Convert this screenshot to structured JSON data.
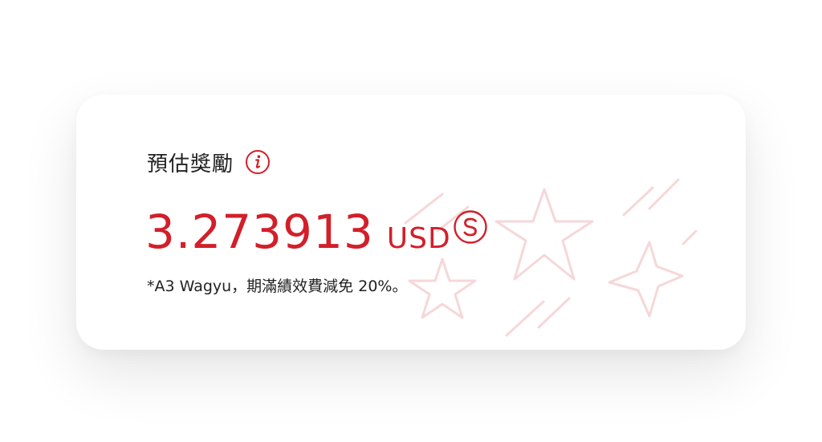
{
  "reward_card": {
    "title": "預估獎勵",
    "amount": "3.273913",
    "currency": "USD",
    "note": "*A3 Wagyu，期滿績效費減免 20%。"
  },
  "icons": {
    "info": "info-icon",
    "coin": "s-coin-icon",
    "decor": "stars-decoration"
  },
  "colors": {
    "accent": "#d21f2a",
    "decor": "#f6d7d9",
    "text": "#222222",
    "card": "#ffffff"
  }
}
